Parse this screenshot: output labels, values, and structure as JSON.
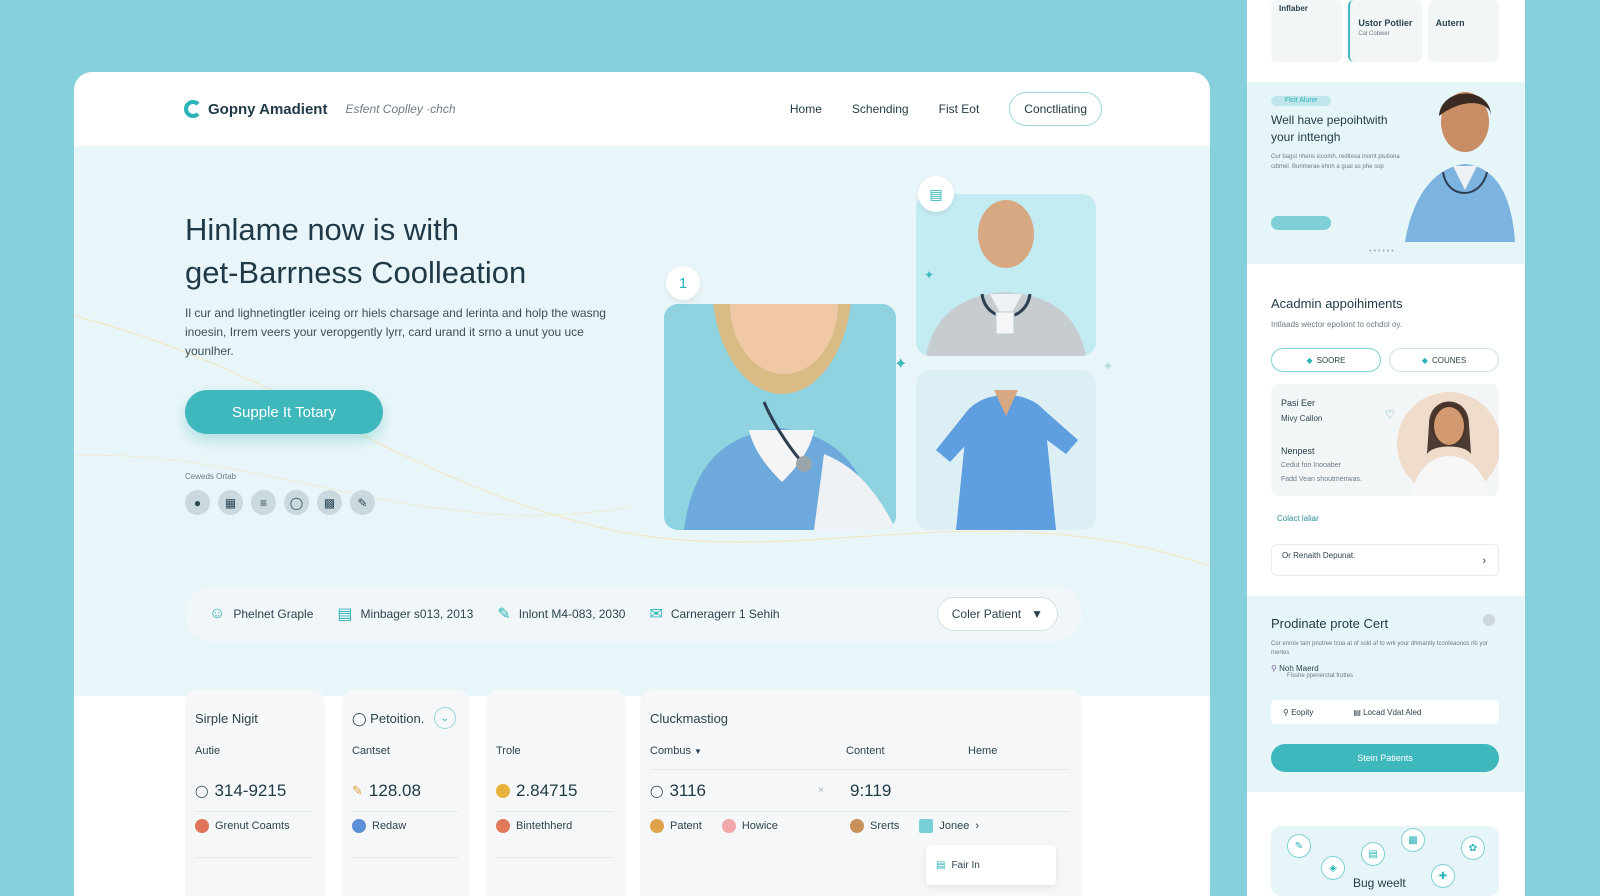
{
  "nav": {
    "brand": "Gopny Amadient",
    "tagline": "Esfent Coplley ·chch",
    "links": [
      "Home",
      "Schending",
      "Fist Eot"
    ],
    "cta": "Conctliating"
  },
  "hero": {
    "title_line1": "Hinlame now is with",
    "title_line2": "get-Barrness Coolleation",
    "text": "Il cur and lighnetingtler iceing orr hiels charsage and lerinta and holp the wasng inoesin, Irrem veers your veropgently lyrr, card urand it srno a unut you uce younlher.",
    "button": "Supple It Totary",
    "small_label": "Ceweds Ortab",
    "badge_number": "1"
  },
  "filters": {
    "items": [
      "Phelnet Graple",
      "Minbager s013, 2013",
      "Inlont M4-083, 2030",
      "Carneragerr 1 Sehih"
    ],
    "select": "Coler Patient"
  },
  "cards": {
    "c1": {
      "title": "Sirple Nigit",
      "sub": "Autie",
      "value": "314-9215",
      "foot": "Grenut Coamts"
    },
    "c2": {
      "title": "Petoition.",
      "sub": "Cantset",
      "value": "128.08",
      "foot": "Redaw"
    },
    "c3": {
      "title": "",
      "sub": "Trole",
      "value": "2.84715",
      "foot": "Bintethherd"
    },
    "c4": {
      "title": "Cluckmastiog",
      "col1": "Combus",
      "col2": "Content",
      "col3": "Heme",
      "value1": "3116",
      "value2": "9:119",
      "foot1": "Patent",
      "foot2": "Howice",
      "foot3": "Srerts",
      "foot4": "Jonee",
      "dropdown": "Fair In"
    }
  },
  "side": {
    "top_boxes": [
      {
        "title": "Inflaber",
        "value": ""
      },
      {
        "title": "Ustor Potlier",
        "value": "Cal Cobwer"
      },
      {
        "title": "Autern",
        "value": ""
      }
    ],
    "promo": {
      "pill": "Flcit Alune",
      "title": "Well have pepoihtwith your inttengh",
      "text": "Cur bagst nhens iccomh, reditesa inomt ptutiona cdtmel. Bunmerae ehnh a gual as phe sop"
    },
    "appointments": {
      "title": "Acadmin appoihiments",
      "sub": "Intlaads wector epoliont to ochdol oy.",
      "pill1": "SOORE",
      "pill2": "COUNES",
      "doc1": "Pasi Eer",
      "doc2": "Mivy Callon",
      "doc3": "Nenpest",
      "doc4": "Cedut fon Inooaber",
      "doc5": "Fadd Vean shoutmenwas.",
      "contact": "Colact laliar",
      "row": "Or Renaith Depunat."
    },
    "section2": {
      "title": "Prodinate prote Cert",
      "text": "Cor enroiv tam pnotree tcoa at of sold af to wrk your dhmantly tconteaonos rib yor mertes",
      "item": "Noh Maerd",
      "item_sub": "Fisshe ppenerctat frottes",
      "search1": "Eopity",
      "search2": "Locad Vdat Aled",
      "button": "Stein Patients"
    },
    "bottom": {
      "text": "Bug weelt"
    }
  },
  "colors": {
    "accent": "#3fb8bd",
    "background": "#86d0dc",
    "hero_bg": "#e9f6f9"
  }
}
